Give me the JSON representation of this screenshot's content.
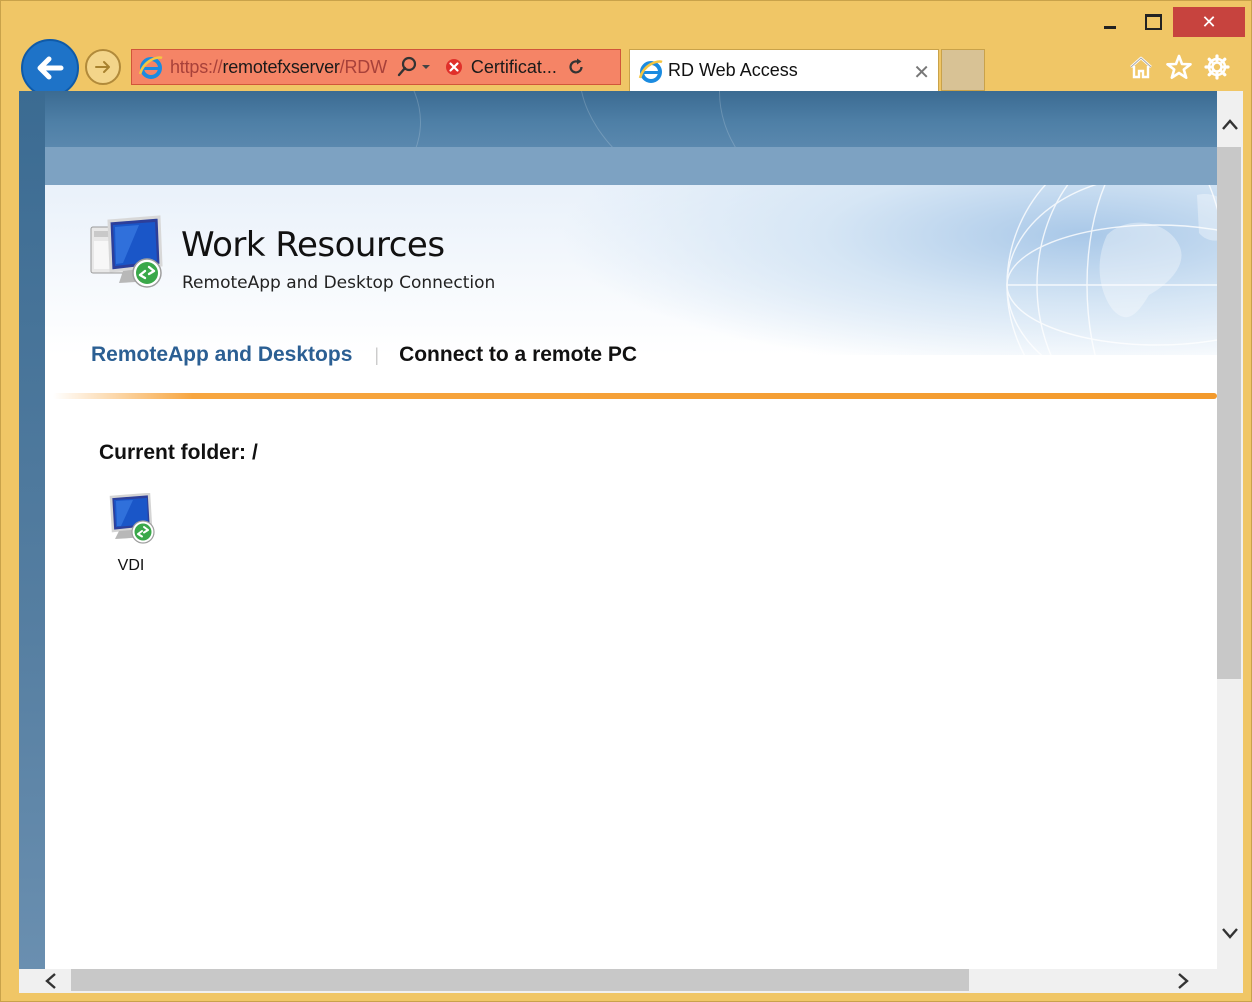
{
  "window": {
    "minimize_icon": "minimize-icon",
    "maximize_icon": "maximize-icon",
    "close_icon": "close-icon",
    "close_color": "#c7433e",
    "frame_color": "#f0c666"
  },
  "navigation": {
    "back_icon": "back-arrow-icon",
    "forward_icon": "forward-arrow-icon"
  },
  "address_bar": {
    "url_scheme": "https://",
    "url_host": "remotefxserver",
    "url_path": "/RDW",
    "certificate_label": "Certificat...",
    "error_color": "#f58466"
  },
  "tabs": [
    {
      "title": "RD Web Access",
      "active": true
    }
  ],
  "toolbar": {
    "home_icon": "home-icon",
    "favorites_icon": "star-icon",
    "settings_icon": "gear-icon"
  },
  "page": {
    "title": "Work Resources",
    "subtitle": "RemoteApp and Desktop Connection",
    "nav": {
      "remoteapp": "RemoteApp and Desktops",
      "connect": "Connect to a remote PC"
    },
    "current_folder_label": "Current folder:",
    "current_folder_path": "/",
    "resources": [
      {
        "label": "VDI",
        "icon": "remote-desktop-icon"
      }
    ],
    "accent_orange": "#f39a2c",
    "nav_link_color": "#2b5f93"
  }
}
